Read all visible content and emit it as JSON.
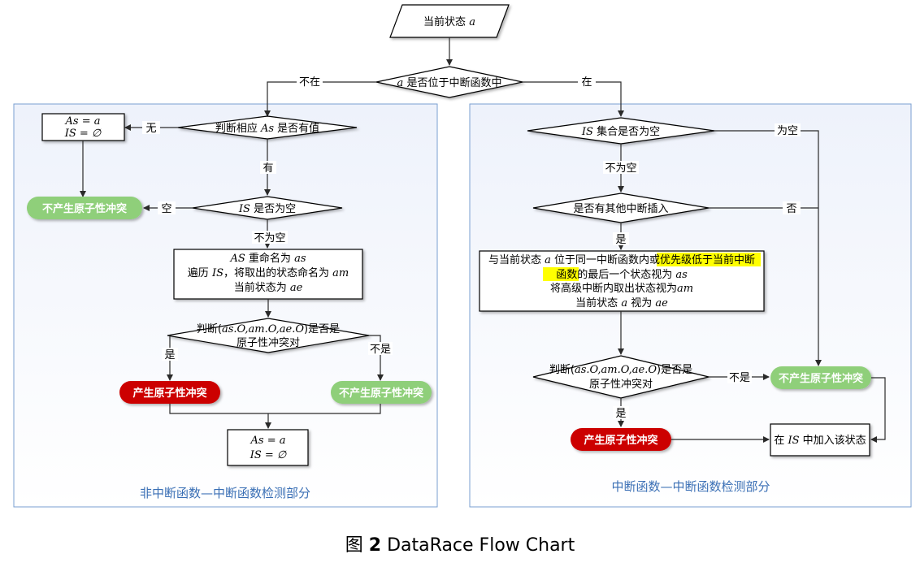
{
  "caption": {
    "prefix": "图",
    "number": "2",
    "title": "DataRace Flow Chart"
  },
  "sections": {
    "left_title": "非中断函数—中断函数检测部分",
    "right_title": "中断函数—中断函数检测部分"
  },
  "top": {
    "start_label": "当前状态",
    "start_var": "a",
    "decision_var": "a",
    "decision_text": "是否位于中断函数中",
    "branch_no": "不在",
    "branch_yes": "在"
  },
  "left": {
    "d1_prefix": "判断相应",
    "d1_var": "As",
    "d1_suffix": "是否有值",
    "d1_none": "无",
    "d1_has": "有",
    "init_box_line1": "As = a",
    "init_box_line2": "IS = ∅",
    "d2_var": "IS",
    "d2_text": "是否为空",
    "d2_empty": "空",
    "d2_notempty": "不为空",
    "no_conflict_1": "不产生原子性冲突",
    "proc_line1_var": "AS",
    "proc_line1_text": "重命名为",
    "proc_line1_var2": "as",
    "proc_line2_prefix": "遍历",
    "proc_line2_var": "IS",
    "proc_line2_mid": "，将取出的状态命名为",
    "proc_line2_var2": "am",
    "proc_line3_text": "当前状态为",
    "proc_line3_var": "ae",
    "d3_line1_prefix": "判断(",
    "d3_line1_vars": "as.O,am.O,ae.O",
    "d3_line1_suffix": ")是否是",
    "d3_line2": "原子性冲突对",
    "d3_yes": "是",
    "d3_no": "不是",
    "conflict": "产生原子性冲突",
    "no_conflict_2": "不产生原子性冲突",
    "end_box_line1": "As = a",
    "end_box_line2": "IS = ∅"
  },
  "right": {
    "d1_var": "IS",
    "d1_text": "集合是否为空",
    "d1_empty": "为空",
    "d1_notempty": "不为空",
    "d2_text": "是否有其他中断插入",
    "d2_no": "否",
    "d2_yes": "是",
    "proc_line1_a": "与当前状态",
    "proc_line1_var": "a",
    "proc_line1_b": "位于同一中断函数内或",
    "proc_line1_hl": "优先级低于当前中断",
    "proc_line2_hl": "函数",
    "proc_line2_b": "的最后一个状态视为",
    "proc_line2_var": "as",
    "proc_line3_text": "将高级中断内取出状态视为",
    "proc_line3_var": "am",
    "proc_line4_a": "当前状态",
    "proc_line4_var": "a",
    "proc_line4_b": "视为",
    "proc_line4_var2": "ae",
    "d3_line1_prefix": "判断(",
    "d3_line1_vars": "as.O,am.O,ae.O",
    "d3_line1_suffix": ")是否是",
    "d3_line2": "原子性冲突对",
    "d3_no": "不是",
    "d3_yes": "是",
    "no_conflict": "不产生原子性冲突",
    "conflict": "产生原子性冲突",
    "add_prefix": "在",
    "add_var": "IS",
    "add_suffix": "中加入该状态"
  },
  "colors": {
    "green": "#8fcf7a",
    "red": "#cc0000",
    "highlight": "#ffff00",
    "section_border": "#7a9fd0",
    "section_title": "#3a6fb5"
  }
}
